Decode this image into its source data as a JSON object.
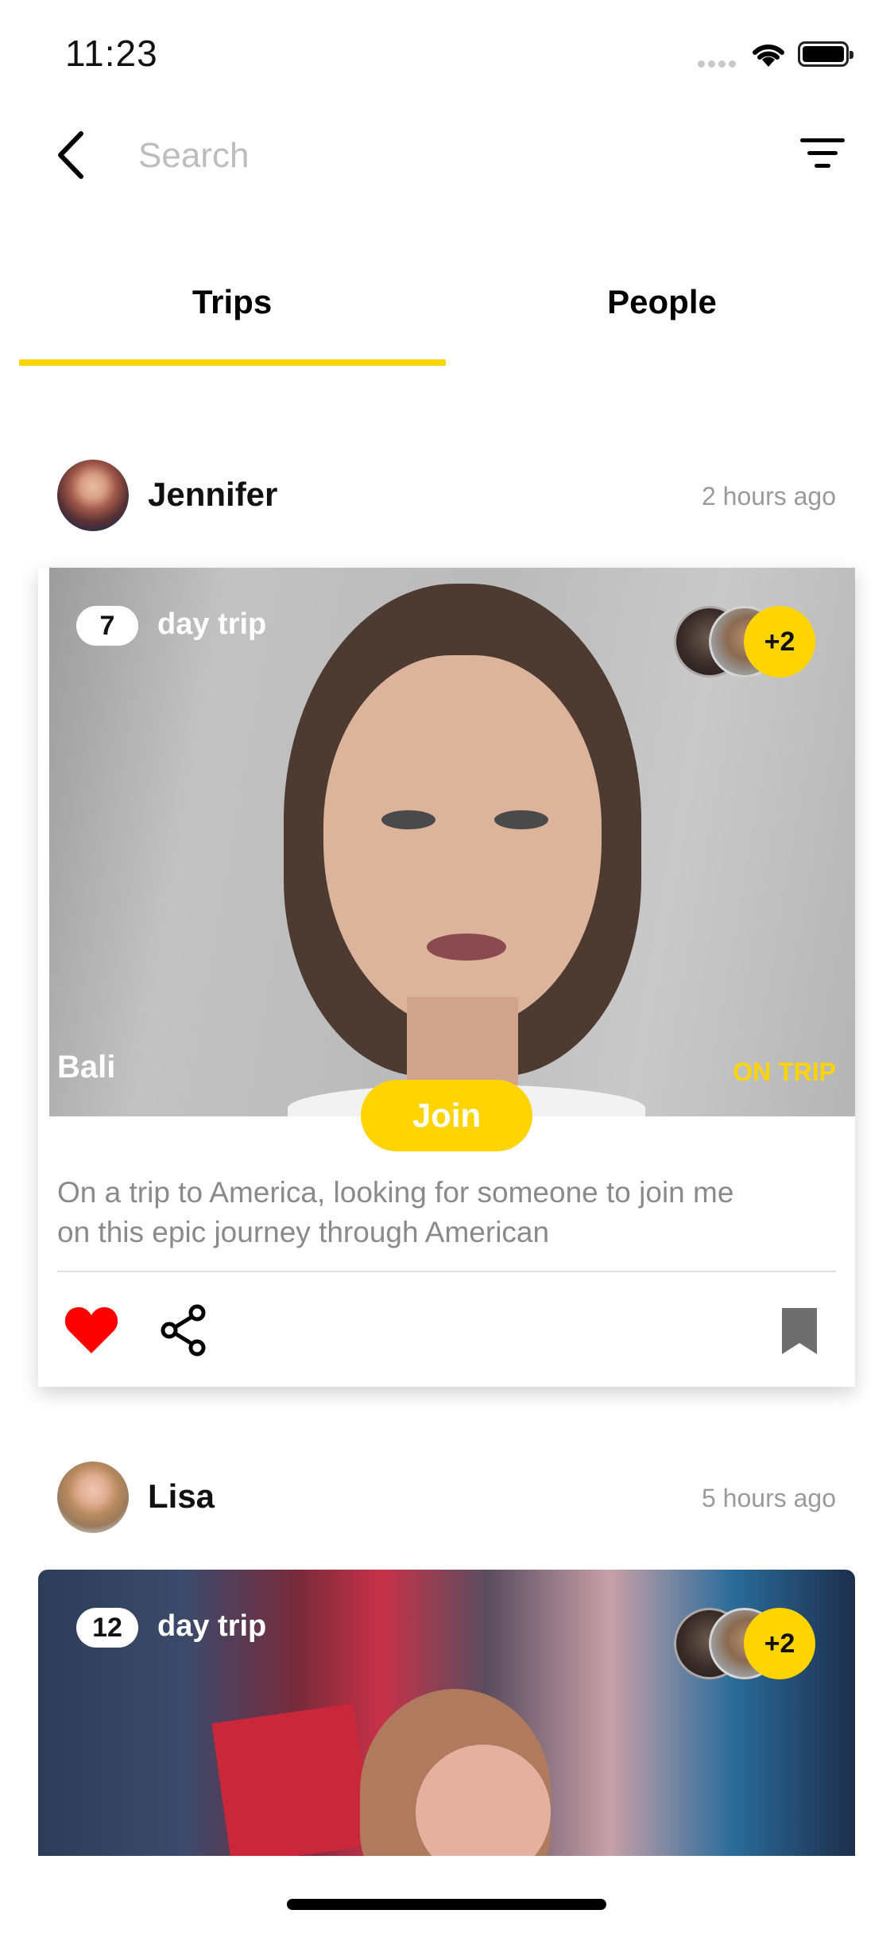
{
  "status_bar": {
    "time": "11:23"
  },
  "search": {
    "placeholder": "Search",
    "value": ""
  },
  "tabs": [
    {
      "label": "Trips",
      "active": true
    },
    {
      "label": "People",
      "active": false
    }
  ],
  "posts": [
    {
      "user": "Jennifer",
      "time": "2 hours ago",
      "days": "7",
      "days_label": "day trip",
      "companions_extra": "+2",
      "location": "Bali",
      "status": "ON TRIP",
      "join_label": "Join",
      "description": "On a trip to America, looking for someone to join me on this epic journey through American",
      "liked": true
    },
    {
      "user": "Lisa",
      "time": "5 hours ago",
      "days": "12",
      "days_label": "day trip",
      "companions_extra": "+2"
    }
  ],
  "colors": {
    "accent": "#ffd400",
    "like": "#ff0000",
    "muted": "#9a9a9a"
  },
  "icons": [
    "back-arrow-icon",
    "filter-icon",
    "heart-icon",
    "share-icon",
    "bookmark-icon"
  ]
}
